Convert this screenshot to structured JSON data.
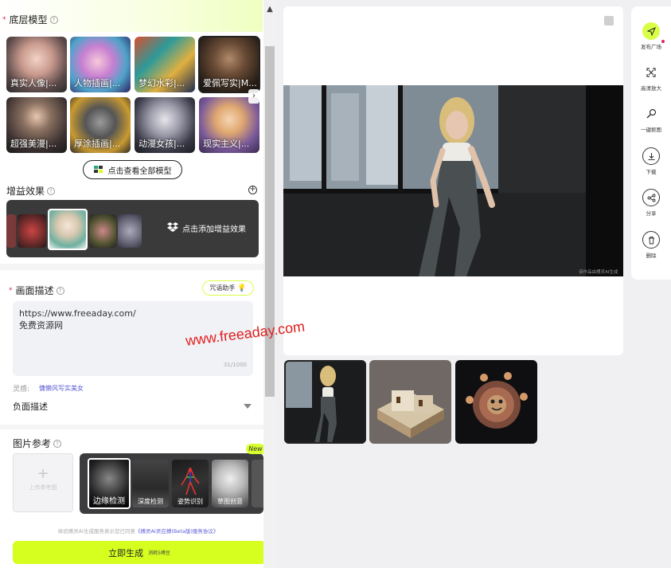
{
  "left": {
    "base_model": {
      "title": "底层模型",
      "required_mark": "*",
      "models": [
        {
          "label": "真实人像|..."
        },
        {
          "label": "人物插画|..."
        },
        {
          "label": "梦幻水彩|..."
        },
        {
          "label": "爱佩写实|M..."
        },
        {
          "label": "超强美漫|..."
        },
        {
          "label": "厚涂插画|..."
        },
        {
          "label": "动漫女孩|..."
        },
        {
          "label": "现实主义|..."
        }
      ],
      "view_all": "点击查看全部模型"
    },
    "boost": {
      "title": "增益效果",
      "add_label": "点击添加增益效果"
    },
    "description": {
      "title": "画面描述",
      "required_mark": "*",
      "assistant": "咒语助手",
      "prompt_line1": "https://www.freeaday.com/",
      "prompt_line2": "免费资源网",
      "counter": "31/1000",
      "inspiration_label": "灵感:",
      "inspiration_tag": "慵懒风写实美女",
      "negative_label": "负面描述"
    },
    "reference": {
      "title": "图片参考",
      "upload_label": "上传参考图",
      "new_badge": "New",
      "controls": [
        {
          "label": "边缘检测"
        },
        {
          "label": "深度检测"
        },
        {
          "label": "姿势识别"
        },
        {
          "label": "草图创意"
        }
      ]
    },
    "agreement_prefix": "体验搏灵AI生成服务表示您已同意",
    "agreement_link": "《搏灵AI灵应搏(Beta版)服务协议》",
    "generate": {
      "label": "立即生成",
      "cost": "消耗5搏豆"
    }
  },
  "canvas": {
    "ai_note": "该作品由搏灵AI生成",
    "watermark": "www.freeaday.com"
  },
  "toolbar": {
    "items": [
      {
        "label": "发布广场",
        "icon": "send-icon"
      },
      {
        "label": "高清放大",
        "icon": "upscale-icon"
      },
      {
        "label": "一键抠图",
        "icon": "cutout-icon"
      },
      {
        "label": "下载",
        "icon": "download-icon"
      },
      {
        "label": "分享",
        "icon": "share-icon"
      },
      {
        "label": "删除",
        "icon": "trash-icon"
      }
    ]
  },
  "colors": {
    "accent": "#d6ff1f",
    "required": "#e0245e",
    "link": "#5b5bd6"
  }
}
